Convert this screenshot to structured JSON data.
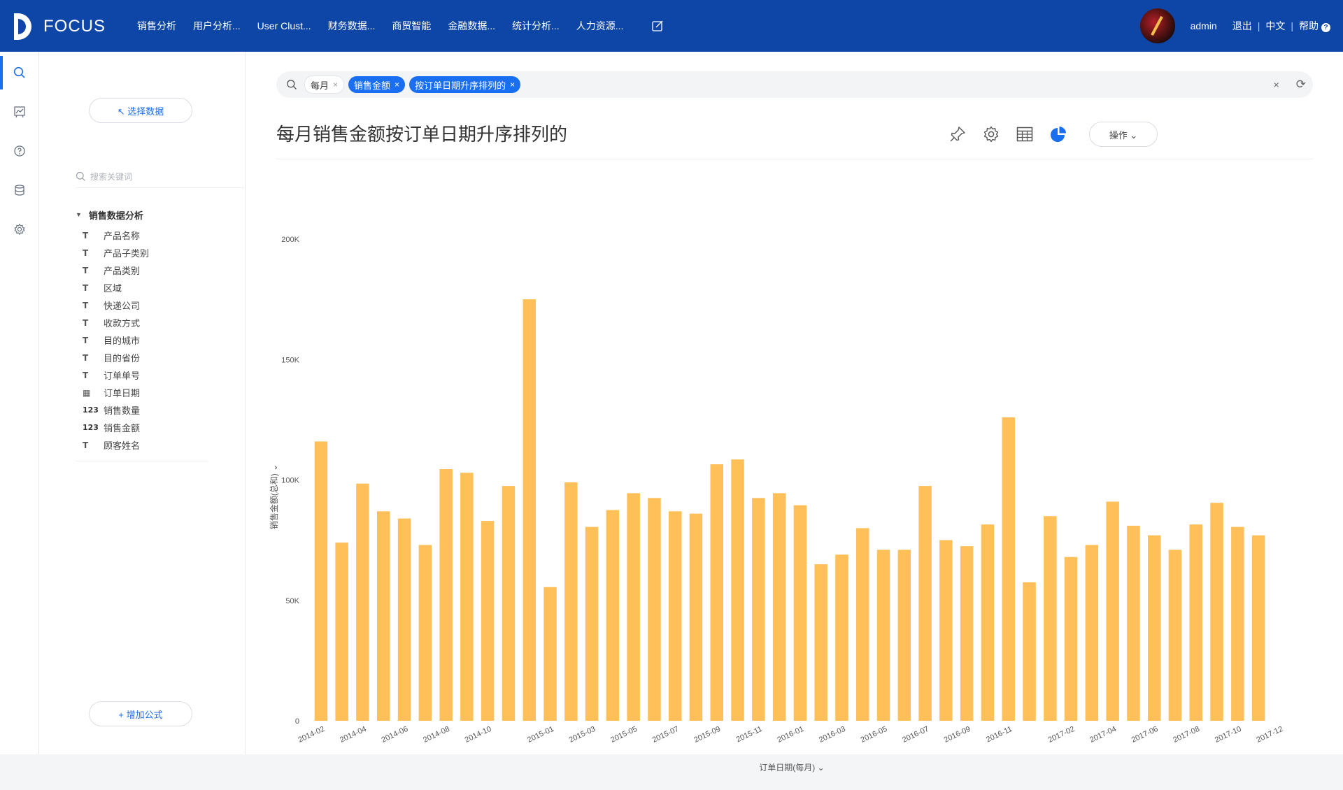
{
  "app": {
    "brand": "FOCUS"
  },
  "nav": [
    "销售分析",
    "用户分析...",
    "User Clust...",
    "财务数据...",
    "商贸智能",
    "金融数据...",
    "统计分析...",
    "人力资源..."
  ],
  "user": {
    "name": "admin",
    "logout": "退出",
    "lang": "中文",
    "help": "帮助",
    "sep": "|",
    "help_glyph": "?"
  },
  "sidebar_icons": [
    "search-icon",
    "chart-board-icon",
    "help-circle-icon",
    "database-icon",
    "settings-icon"
  ],
  "data_panel": {
    "select_data": "↖ 选择数据",
    "search_placeholder": "搜索关键词",
    "group": "销售数据分析",
    "fields": [
      {
        "type": "text",
        "label": "产品名称"
      },
      {
        "type": "text",
        "label": "产品子类别"
      },
      {
        "type": "text",
        "label": "产品类别"
      },
      {
        "type": "text",
        "label": "区域"
      },
      {
        "type": "text",
        "label": "快递公司"
      },
      {
        "type": "text",
        "label": "收款方式"
      },
      {
        "type": "text",
        "label": "目的城市"
      },
      {
        "type": "text",
        "label": "目的省份"
      },
      {
        "type": "text",
        "label": "订单单号"
      },
      {
        "type": "date",
        "label": "订单日期"
      },
      {
        "type": "number",
        "label": "销售数量"
      },
      {
        "type": "number",
        "label": "销售金额"
      },
      {
        "type": "text",
        "label": "顾客姓名"
      }
    ],
    "add_formula": "+ 增加公式",
    "type_glyphs": {
      "text": "T",
      "date": "▦",
      "number": "123"
    }
  },
  "query": {
    "tokens": [
      {
        "label": "每月",
        "style": "plain"
      },
      {
        "label": "销售金额",
        "style": "blue"
      },
      {
        "label": "按订单日期升序排列的",
        "style": "blue"
      }
    ],
    "close_glyph": "×",
    "clear_glyph": "×",
    "refresh_glyph": "⟳"
  },
  "page_title": "每月销售金额按订单日期升序排列的",
  "toolbar": {
    "operate": "操作 ⌄"
  },
  "colors": {
    "topbar": "#0e46a8",
    "accent": "#1a6ef0",
    "bar": "#ffc05a"
  },
  "chart_data": {
    "type": "bar",
    "ylabel": "销售金额(总和) ⌄",
    "xlabel": "订单日期(每月) ⌄",
    "ylim": [
      0,
      200000
    ],
    "yticks": [
      0,
      50000,
      100000,
      150000,
      200000
    ],
    "ytick_labels": [
      "0",
      "50K",
      "100K",
      "150K",
      "200K"
    ],
    "categories": [
      "2014-02",
      "2014-03",
      "2014-04",
      "2014-05",
      "2014-06",
      "2014-07",
      "2014-08",
      "2014-09",
      "2014-10",
      "2014-11",
      "2014-12",
      "2015-01",
      "2015-02",
      "2015-03",
      "2015-04",
      "2015-05",
      "2015-06",
      "2015-07",
      "2015-08",
      "2015-09",
      "2015-10",
      "2015-11",
      "2015-12",
      "2016-01",
      "2016-02",
      "2016-03",
      "2016-04",
      "2016-05",
      "2016-06",
      "2016-07",
      "2016-08",
      "2016-09",
      "2016-10",
      "2016-11",
      "2016-12",
      "2017-01",
      "2017-02",
      "2017-03",
      "2017-04",
      "2017-05",
      "2017-06",
      "2017-07",
      "2017-08",
      "2017-09",
      "2017-10",
      "2017-11",
      "2017-12"
    ],
    "values": [
      116000,
      74000,
      98500,
      87000,
      84000,
      73000,
      104500,
      103000,
      83000,
      97500,
      175000,
      55500,
      99000,
      80500,
      87500,
      94500,
      92500,
      87000,
      86000,
      106500,
      108500,
      92500,
      94500,
      89500,
      65000,
      69000,
      80000,
      71000,
      71000,
      97500,
      75000,
      72500,
      81500,
      126000,
      57500,
      85000,
      68000,
      73000,
      91000,
      81000,
      77000,
      71000,
      81500,
      90500,
      80500,
      77000
    ],
    "tick_labels": [
      "2014-02",
      "2014-04",
      "2014-06",
      "2014-08",
      "2014-10",
      "2015-01",
      "2015-03",
      "2015-05",
      "2015-07",
      "2015-09",
      "2015-11",
      "2016-01",
      "2016-03",
      "2016-05",
      "2016-07",
      "2016-09",
      "2016-11",
      "2017-02",
      "2017-04",
      "2017-06",
      "2017-08",
      "2017-10",
      "2017-12"
    ]
  }
}
